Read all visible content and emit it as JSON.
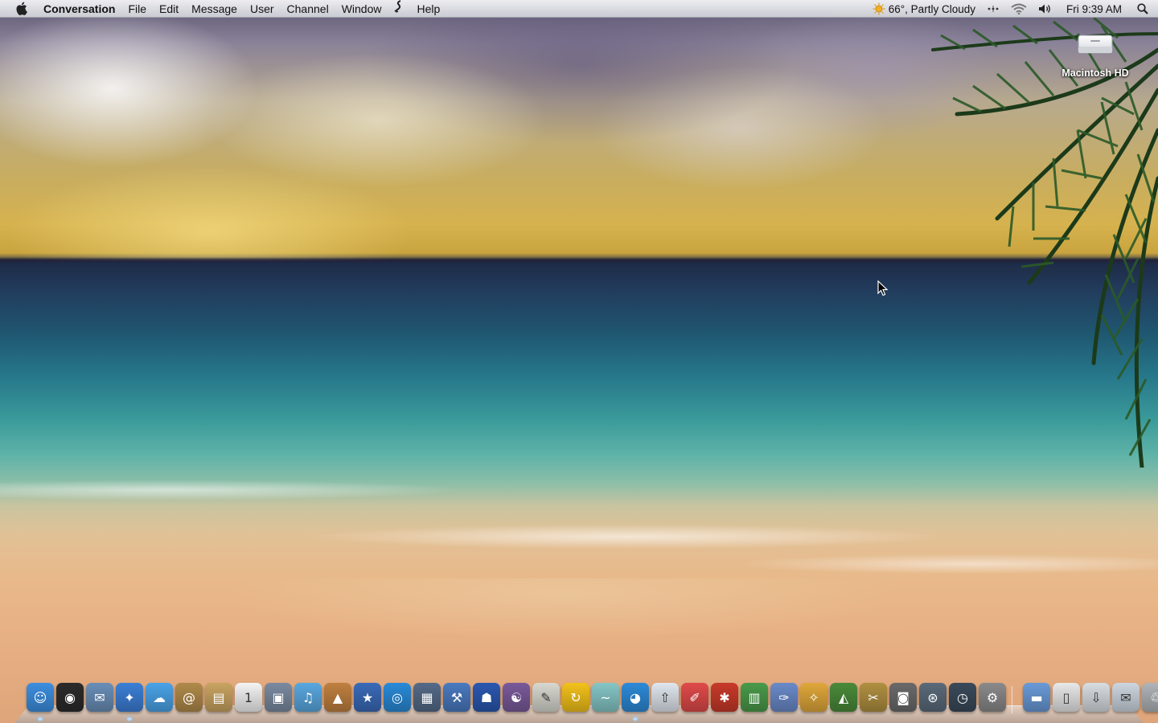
{
  "menubar": {
    "app_name": "Conversation",
    "menus": [
      "File",
      "Edit",
      "Message",
      "User",
      "Channel",
      "Window",
      "Help"
    ],
    "weather": "66°, Partly Cloudy",
    "clock": "Fri 9:39 AM",
    "icons": [
      "apple-icon",
      "script-icon",
      "weather-sun-icon",
      "bluetooth-dots-icon",
      "wifi-icon",
      "volume-icon",
      "spotlight-search-icon"
    ]
  },
  "desktop": {
    "drive_label": "Macintosh HD"
  },
  "dock": {
    "items": [
      {
        "name": "finder",
        "color": "#3d8fe0",
        "glyph": "☺"
      },
      {
        "name": "dashboard",
        "color": "#2b2b2b",
        "glyph": "◉"
      },
      {
        "name": "mail-stamp",
        "color": "#6a8fb8",
        "glyph": "✉"
      },
      {
        "name": "safari",
        "color": "#3c7fd6",
        "glyph": "✦"
      },
      {
        "name": "ichat",
        "color": "#4aa3e8",
        "glyph": "☁"
      },
      {
        "name": "address-book",
        "color": "#b08a4a",
        "glyph": "@"
      },
      {
        "name": "iphoto-calendar",
        "color": "#c9a461",
        "glyph": "▤"
      },
      {
        "name": "ical",
        "color": "#f4f4f4",
        "glyph": "1"
      },
      {
        "name": "preview",
        "color": "#7a8aa0",
        "glyph": "▣"
      },
      {
        "name": "itunes",
        "color": "#5aa8e0",
        "glyph": "♫"
      },
      {
        "name": "iphoto",
        "color": "#c08040",
        "glyph": "▲"
      },
      {
        "name": "imovie",
        "color": "#3a6ab8",
        "glyph": "★"
      },
      {
        "name": "idvd",
        "color": "#2a8ad8",
        "glyph": "◎"
      },
      {
        "name": "spaces",
        "color": "#556a88",
        "glyph": "▦"
      },
      {
        "name": "xcode",
        "color": "#4a7ac0",
        "glyph": "⚒"
      },
      {
        "name": "automator",
        "color": "#2a58b0",
        "glyph": "☗"
      },
      {
        "name": "colloquy",
        "color": "#7a5a9a",
        "glyph": "☯"
      },
      {
        "name": "textedit",
        "color": "#d8d8d0",
        "glyph": "✎"
      },
      {
        "name": "sync",
        "color": "#f3c21a",
        "glyph": "↻"
      },
      {
        "name": "twhirl",
        "color": "#86c6c6",
        "glyph": "~"
      },
      {
        "name": "adium",
        "color": "#2d8ad8",
        "glyph": "◕"
      },
      {
        "name": "flickr-uploadr",
        "color": "#e0e6ee",
        "glyph": "⇧"
      },
      {
        "name": "css-edit",
        "color": "#e04a4a",
        "glyph": "✐"
      },
      {
        "name": "ladybug",
        "color": "#c83a2a",
        "glyph": "✱"
      },
      {
        "name": "numbers",
        "color": "#4a9a4a",
        "glyph": "▥"
      },
      {
        "name": "pages",
        "color": "#6a8ac8",
        "glyph": "✑"
      },
      {
        "name": "keynote",
        "color": "#e0a83a",
        "glyph": "✧"
      },
      {
        "name": "coda",
        "color": "#4a8a3a",
        "glyph": "◭"
      },
      {
        "name": "photo-booth",
        "color": "#b09040",
        "glyph": "✂"
      },
      {
        "name": "screenshot",
        "color": "#6a6a6a",
        "glyph": "◙"
      },
      {
        "name": "network-utility",
        "color": "#5a6a7a",
        "glyph": "⊛"
      },
      {
        "name": "time-machine",
        "color": "#3a4a5a",
        "glyph": "◷"
      },
      {
        "name": "system-preferences",
        "color": "#8a8a8a",
        "glyph": "⚙"
      },
      {
        "name": "applications-folder",
        "color": "#6a9ad8",
        "glyph": "▬"
      },
      {
        "name": "documents-stack",
        "color": "#e8e8e8",
        "glyph": "▯"
      },
      {
        "name": "downloads-stack",
        "color": "#d8dde2",
        "glyph": "⇩"
      },
      {
        "name": "mail-stack",
        "color": "#cdd6e0",
        "glyph": "✉"
      },
      {
        "name": "trash",
        "color": "#b0b4b8",
        "glyph": "♲"
      }
    ]
  }
}
